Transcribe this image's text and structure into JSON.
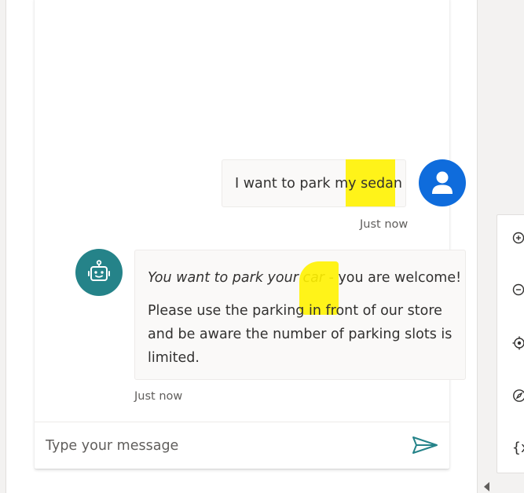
{
  "conversation": {
    "user_message": {
      "text_before_highlight": "I want to park my ",
      "highlighted_text": "sedan",
      "timestamp": "Just now"
    },
    "bot_message": {
      "italic_text": "You want to park your car",
      "text_after_italic": " - you are welcome!",
      "paragraph": "Please use the parking in front of our store and be aware the number of parking slots is limited.",
      "timestamp": "Just now"
    }
  },
  "composer": {
    "placeholder": "Type your message"
  },
  "toolbar": {
    "variables_label": "{x"
  },
  "colors": {
    "user_avatar": "#0f6cdc",
    "bot_avatar": "#258389",
    "highlight": "#fff200",
    "send_icon": "#258389"
  }
}
